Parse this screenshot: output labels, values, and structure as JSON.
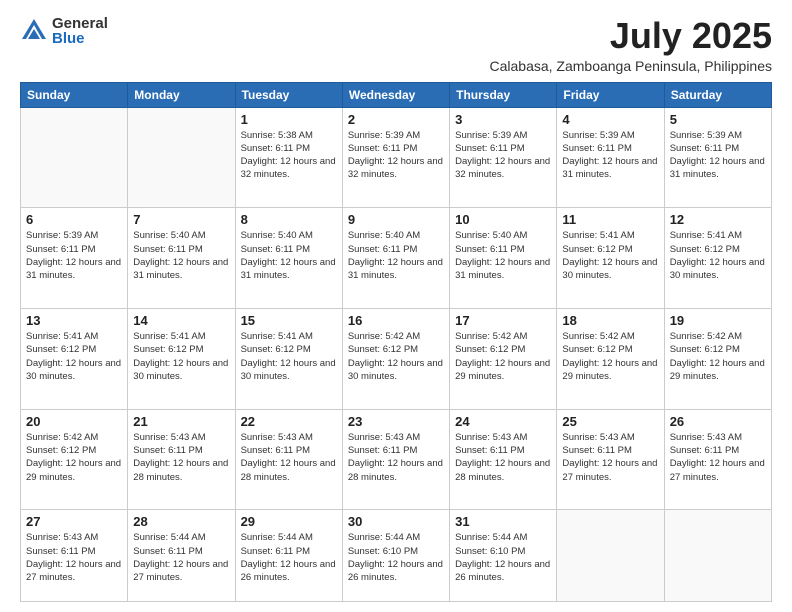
{
  "logo": {
    "general": "General",
    "blue": "Blue"
  },
  "title": {
    "month_year": "July 2025",
    "location": "Calabasa, Zamboanga Peninsula, Philippines"
  },
  "days_of_week": [
    "Sunday",
    "Monday",
    "Tuesday",
    "Wednesday",
    "Thursday",
    "Friday",
    "Saturday"
  ],
  "weeks": [
    [
      {
        "day": "",
        "info": ""
      },
      {
        "day": "",
        "info": ""
      },
      {
        "day": "1",
        "info": "Sunrise: 5:38 AM\nSunset: 6:11 PM\nDaylight: 12 hours and 32 minutes."
      },
      {
        "day": "2",
        "info": "Sunrise: 5:39 AM\nSunset: 6:11 PM\nDaylight: 12 hours and 32 minutes."
      },
      {
        "day": "3",
        "info": "Sunrise: 5:39 AM\nSunset: 6:11 PM\nDaylight: 12 hours and 32 minutes."
      },
      {
        "day": "4",
        "info": "Sunrise: 5:39 AM\nSunset: 6:11 PM\nDaylight: 12 hours and 31 minutes."
      },
      {
        "day": "5",
        "info": "Sunrise: 5:39 AM\nSunset: 6:11 PM\nDaylight: 12 hours and 31 minutes."
      }
    ],
    [
      {
        "day": "6",
        "info": "Sunrise: 5:39 AM\nSunset: 6:11 PM\nDaylight: 12 hours and 31 minutes."
      },
      {
        "day": "7",
        "info": "Sunrise: 5:40 AM\nSunset: 6:11 PM\nDaylight: 12 hours and 31 minutes."
      },
      {
        "day": "8",
        "info": "Sunrise: 5:40 AM\nSunset: 6:11 PM\nDaylight: 12 hours and 31 minutes."
      },
      {
        "day": "9",
        "info": "Sunrise: 5:40 AM\nSunset: 6:11 PM\nDaylight: 12 hours and 31 minutes."
      },
      {
        "day": "10",
        "info": "Sunrise: 5:40 AM\nSunset: 6:11 PM\nDaylight: 12 hours and 31 minutes."
      },
      {
        "day": "11",
        "info": "Sunrise: 5:41 AM\nSunset: 6:12 PM\nDaylight: 12 hours and 30 minutes."
      },
      {
        "day": "12",
        "info": "Sunrise: 5:41 AM\nSunset: 6:12 PM\nDaylight: 12 hours and 30 minutes."
      }
    ],
    [
      {
        "day": "13",
        "info": "Sunrise: 5:41 AM\nSunset: 6:12 PM\nDaylight: 12 hours and 30 minutes."
      },
      {
        "day": "14",
        "info": "Sunrise: 5:41 AM\nSunset: 6:12 PM\nDaylight: 12 hours and 30 minutes."
      },
      {
        "day": "15",
        "info": "Sunrise: 5:41 AM\nSunset: 6:12 PM\nDaylight: 12 hours and 30 minutes."
      },
      {
        "day": "16",
        "info": "Sunrise: 5:42 AM\nSunset: 6:12 PM\nDaylight: 12 hours and 30 minutes."
      },
      {
        "day": "17",
        "info": "Sunrise: 5:42 AM\nSunset: 6:12 PM\nDaylight: 12 hours and 29 minutes."
      },
      {
        "day": "18",
        "info": "Sunrise: 5:42 AM\nSunset: 6:12 PM\nDaylight: 12 hours and 29 minutes."
      },
      {
        "day": "19",
        "info": "Sunrise: 5:42 AM\nSunset: 6:12 PM\nDaylight: 12 hours and 29 minutes."
      }
    ],
    [
      {
        "day": "20",
        "info": "Sunrise: 5:42 AM\nSunset: 6:12 PM\nDaylight: 12 hours and 29 minutes."
      },
      {
        "day": "21",
        "info": "Sunrise: 5:43 AM\nSunset: 6:11 PM\nDaylight: 12 hours and 28 minutes."
      },
      {
        "day": "22",
        "info": "Sunrise: 5:43 AM\nSunset: 6:11 PM\nDaylight: 12 hours and 28 minutes."
      },
      {
        "day": "23",
        "info": "Sunrise: 5:43 AM\nSunset: 6:11 PM\nDaylight: 12 hours and 28 minutes."
      },
      {
        "day": "24",
        "info": "Sunrise: 5:43 AM\nSunset: 6:11 PM\nDaylight: 12 hours and 28 minutes."
      },
      {
        "day": "25",
        "info": "Sunrise: 5:43 AM\nSunset: 6:11 PM\nDaylight: 12 hours and 27 minutes."
      },
      {
        "day": "26",
        "info": "Sunrise: 5:43 AM\nSunset: 6:11 PM\nDaylight: 12 hours and 27 minutes."
      }
    ],
    [
      {
        "day": "27",
        "info": "Sunrise: 5:43 AM\nSunset: 6:11 PM\nDaylight: 12 hours and 27 minutes."
      },
      {
        "day": "28",
        "info": "Sunrise: 5:44 AM\nSunset: 6:11 PM\nDaylight: 12 hours and 27 minutes."
      },
      {
        "day": "29",
        "info": "Sunrise: 5:44 AM\nSunset: 6:11 PM\nDaylight: 12 hours and 26 minutes."
      },
      {
        "day": "30",
        "info": "Sunrise: 5:44 AM\nSunset: 6:10 PM\nDaylight: 12 hours and 26 minutes."
      },
      {
        "day": "31",
        "info": "Sunrise: 5:44 AM\nSunset: 6:10 PM\nDaylight: 12 hours and 26 minutes."
      },
      {
        "day": "",
        "info": ""
      },
      {
        "day": "",
        "info": ""
      }
    ]
  ]
}
